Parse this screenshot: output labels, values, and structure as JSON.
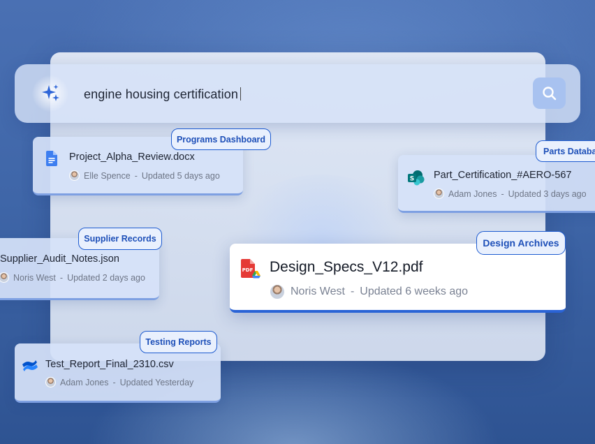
{
  "search": {
    "query": "engine housing certification"
  },
  "results": [
    {
      "tag": "Programs Dashboard",
      "file": "Project_Alpha_Review.docx",
      "author": "Elle Spence",
      "updated": "Updated 5 days ago",
      "icon": "google-docs-icon"
    },
    {
      "tag": "Parts Databa",
      "file": "Part_Certification_#AERO-567",
      "author": "Adam Jones",
      "updated": "Updated 3 days ago",
      "icon": "sharepoint-icon"
    },
    {
      "tag": "Supplier Records",
      "file": "Supplier_Audit_Notes.json",
      "author": "Noris West",
      "updated": "Updated 2 days ago",
      "icon": "none"
    },
    {
      "tag": "Design Archives",
      "file": "Design_Specs_V12.pdf",
      "author": "Noris West",
      "updated": "Updated 6 weeks ago",
      "icon": "pdf-drive-icon"
    },
    {
      "tag": "Testing Reports",
      "file": "Test_Report_Final_2310.csv",
      "author": "Adam Jones",
      "updated": "Updated Yesterday",
      "icon": "confluence-icon"
    }
  ],
  "separator": "-",
  "colors": {
    "accent": "#1d5bd0",
    "card_border": "#7ea0e2",
    "search_button": "#a8c2f0"
  }
}
